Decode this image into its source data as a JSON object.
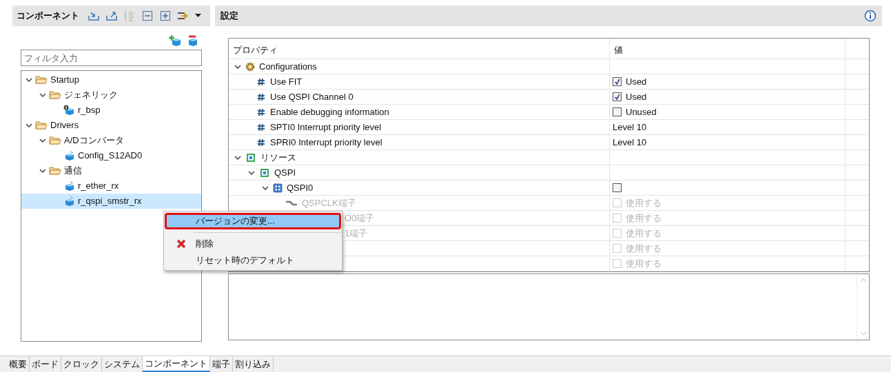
{
  "components_panel": {
    "title": "コンポーネント",
    "filter": {
      "placeholder": "フィルタ入力"
    },
    "tree": [
      {
        "label": "Startup",
        "kind": "folder",
        "expanded": true,
        "selected": false,
        "children": [
          {
            "label": "ジェネリック",
            "kind": "folder",
            "expanded": true,
            "selected": false,
            "children": [
              {
                "label": "r_bsp",
                "kind": "component_info",
                "selected": false
              }
            ]
          }
        ]
      },
      {
        "label": "Drivers",
        "kind": "folder",
        "expanded": true,
        "selected": false,
        "children": [
          {
            "label": "A/Dコンバータ",
            "kind": "folder",
            "expanded": true,
            "selected": false,
            "children": [
              {
                "label": "Config_S12AD0",
                "kind": "component",
                "selected": false
              }
            ]
          },
          {
            "label": "通信",
            "kind": "folder",
            "expanded": true,
            "selected": false,
            "children": [
              {
                "label": "r_ether_rx",
                "kind": "component",
                "selected": false
              },
              {
                "label": "r_qspi_smstr_rx",
                "kind": "component",
                "selected": true
              }
            ]
          }
        ]
      }
    ]
  },
  "settings_panel": {
    "title": "設定",
    "table": {
      "columns": [
        "プロパティ",
        "値"
      ],
      "rows": [
        {
          "property": "Configurations",
          "kind": "group",
          "expanded": true,
          "children": [
            {
              "property": "Use FIT",
              "kind": "setting",
              "value": {
                "kind": "checkbox",
                "checked": true,
                "label": "Used"
              }
            },
            {
              "property": "Use QSPI Channel 0",
              "kind": "setting",
              "value": {
                "kind": "checkbox",
                "checked": true,
                "label": "Used"
              }
            },
            {
              "property": "Enable debugging information",
              "kind": "setting",
              "value": {
                "kind": "checkbox",
                "checked": false,
                "label": "Unused"
              }
            },
            {
              "property": "SPTI0 Interrupt priority level",
              "kind": "setting",
              "value": {
                "kind": "text",
                "label": "Level 10"
              }
            },
            {
              "property": "SPRI0 Interrupt priority level",
              "kind": "setting",
              "value": {
                "kind": "text",
                "label": "Level 10"
              }
            }
          ]
        },
        {
          "property": "リソース",
          "kind": "chip",
          "expanded": true,
          "children": [
            {
              "property": "QSPI",
              "kind": "chip",
              "expanded": true,
              "children": [
                {
                  "property": "QSPI0",
                  "kind": "channel",
                  "expanded": true,
                  "value": {
                    "kind": "checkbox",
                    "checked": false,
                    "disabled": false
                  },
                  "children": [
                    {
                      "property": "QSPCLK端子",
                      "kind": "pin",
                      "value": {
                        "kind": "checkbox",
                        "checked": false,
                        "disabled": true,
                        "label": "使用する"
                      }
                    },
                    {
                      "property": "O0端子",
                      "kind": "covered_pin",
                      "value": {
                        "kind": "checkbox",
                        "checked": false,
                        "disabled": true,
                        "label": "使用する"
                      }
                    },
                    {
                      "property": "1端子",
                      "kind": "covered_pin",
                      "value": {
                        "kind": "checkbox",
                        "checked": false,
                        "disabled": true,
                        "label": "使用する"
                      }
                    },
                    {
                      "kind": "covered_pin",
                      "value": {
                        "kind": "checkbox",
                        "checked": false,
                        "disabled": true,
                        "label": "使用する"
                      }
                    },
                    {
                      "kind": "covered_pin",
                      "value": {
                        "kind": "checkbox",
                        "checked": false,
                        "disabled": true,
                        "label": "使用する"
                      }
                    }
                  ]
                }
              ]
            }
          ]
        }
      ]
    }
  },
  "context_menu": {
    "items": [
      {
        "label": "バージョンの変更...",
        "kind": "plain",
        "selected": true
      },
      {
        "label": "削除",
        "kind": "delete",
        "selected": false
      },
      {
        "label": "リセット時のデフォルト",
        "kind": "plain",
        "selected": false
      }
    ]
  },
  "bottom_tabs": [
    {
      "label": "概要",
      "selected": false
    },
    {
      "label": "ボード",
      "selected": false
    },
    {
      "label": "クロック",
      "selected": false
    },
    {
      "label": "システム",
      "selected": false
    },
    {
      "label": "コンポーネント",
      "selected": true
    },
    {
      "label": "端子",
      "selected": false
    },
    {
      "label": "割り込み",
      "selected": false
    }
  ]
}
